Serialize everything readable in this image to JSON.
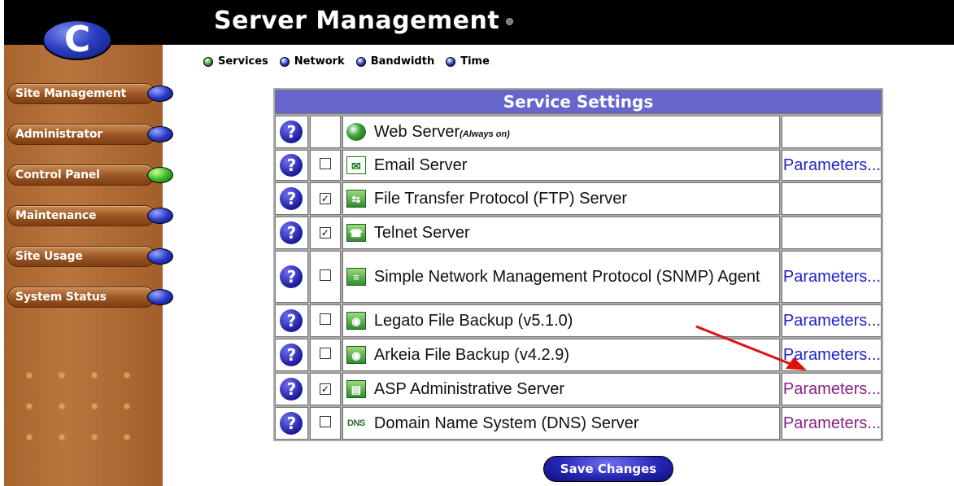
{
  "header": {
    "title": "Server Management"
  },
  "logo": {
    "letter": "C"
  },
  "sidebar": {
    "items": [
      {
        "label": "Site Management",
        "orb": "blue"
      },
      {
        "label": "Administrator",
        "orb": "blue"
      },
      {
        "label": "Control Panel",
        "orb": "green"
      },
      {
        "label": "Maintenance",
        "orb": "blue"
      },
      {
        "label": "Site Usage",
        "orb": "blue"
      },
      {
        "label": "System Status",
        "orb": "blue"
      }
    ]
  },
  "tabs": [
    {
      "label": "Services",
      "color": "#2f9e2f"
    },
    {
      "label": "Network",
      "color": "#2a38c8"
    },
    {
      "label": "Bandwidth",
      "color": "#2a38c8"
    },
    {
      "label": "Time",
      "color": "#2a38c8"
    }
  ],
  "table": {
    "title": "Service Settings",
    "help_glyph": "?",
    "check_glyph": "✓",
    "rows": [
      {
        "name": "Web Server",
        "note": "(Always on)",
        "icon": "globe-icon",
        "checkbox": null,
        "param": ""
      },
      {
        "name": "Email Server",
        "icon": "envelope-icon",
        "checkbox": false,
        "param": "Parameters..."
      },
      {
        "name": "File Transfer Protocol (FTP) Server",
        "icon": "ftp-icon",
        "checkbox": true,
        "param": ""
      },
      {
        "name": "Telnet Server",
        "icon": "telephone-icon",
        "checkbox": true,
        "param": ""
      },
      {
        "name": "Simple Network Management Protocol (SNMP) Agent",
        "icon": "snmp-icon",
        "checkbox": false,
        "param": "Parameters..."
      },
      {
        "name": "Legato File Backup (v5.1.0)",
        "icon": "backup-icon",
        "checkbox": false,
        "param": "Parameters..."
      },
      {
        "name": "Arkeia File Backup (v4.2.9)",
        "icon": "backup-icon",
        "checkbox": false,
        "param": "Parameters..."
      },
      {
        "name": "ASP Administrative Server",
        "icon": "document-icon",
        "checkbox": true,
        "param": "Parameters..."
      },
      {
        "name": "Domain Name System (DNS) Server",
        "icon": "dns-icon",
        "icon_text": "DNS",
        "checkbox": false,
        "param": "Parameters..."
      }
    ]
  },
  "save_button": {
    "label": "Save Changes"
  },
  "colors": {
    "header_bg": "#000000",
    "sidebar_bg": "#b8753e",
    "table_header_bg": "#6666cc",
    "link_blue": "#2222cc",
    "link_visited": "#882288",
    "arrow": "#e01010"
  }
}
